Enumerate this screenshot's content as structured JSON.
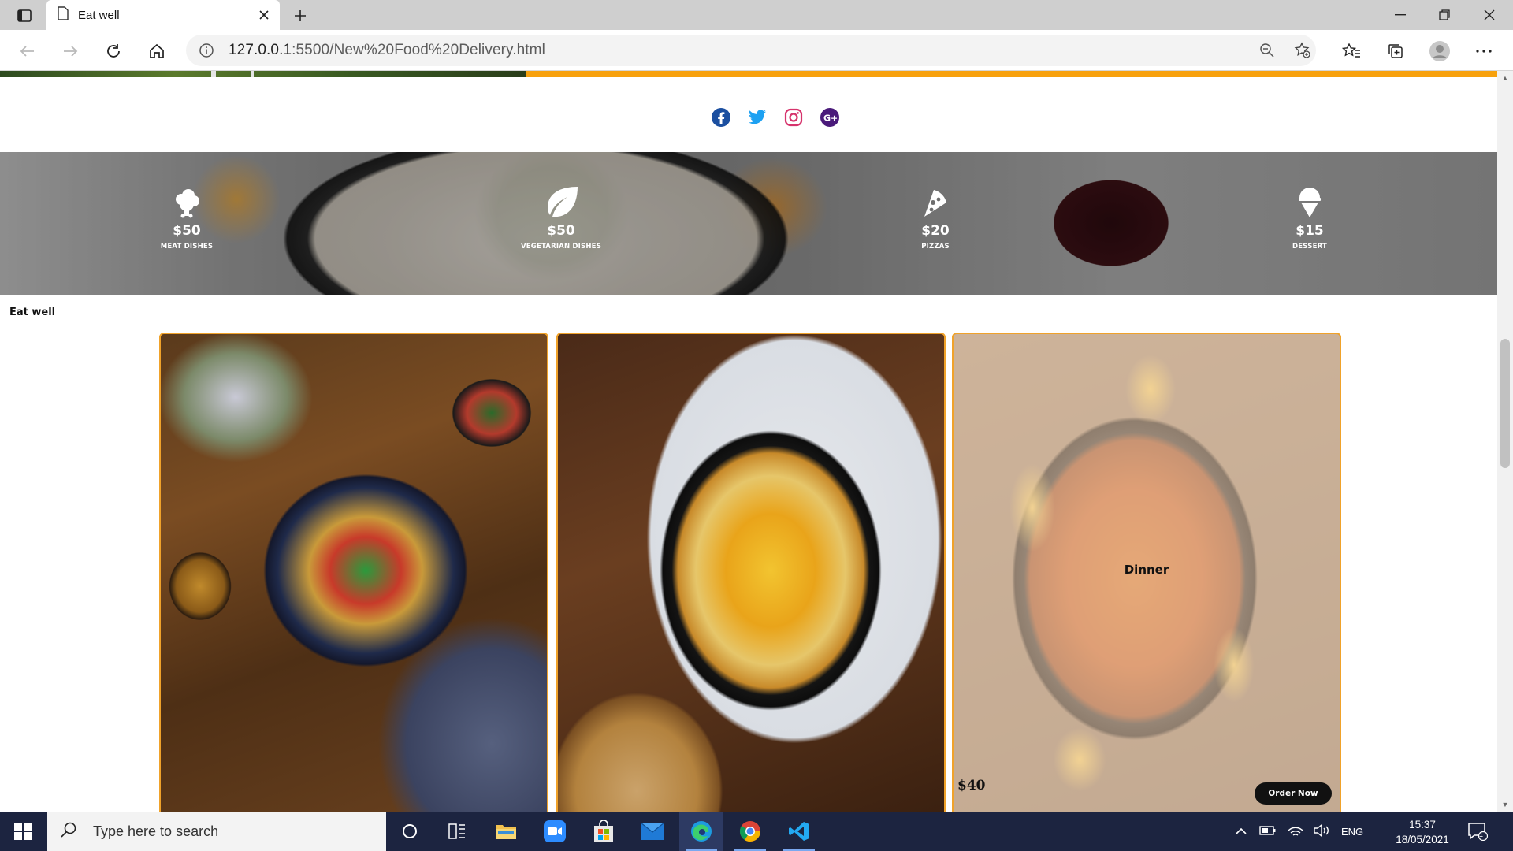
{
  "browser": {
    "tab_title": "Eat well",
    "url_host": "127.0.0.1",
    "url_path": ":5500/New%20Food%20Delivery.html"
  },
  "social": [
    "facebook-icon",
    "twitter-icon",
    "instagram-icon",
    "google-plus-icon"
  ],
  "prices": [
    {
      "amount": "$50",
      "label": "MEAT DISHES",
      "icon": "meat-icon"
    },
    {
      "amount": "$50",
      "label": "VEGETARIAN DISHES",
      "icon": "leaf-icon"
    },
    {
      "amount": "$20",
      "label": "PIZZAS",
      "icon": "pizza-icon"
    },
    {
      "amount": "$15",
      "label": "DESSERT",
      "icon": "ice-cream-icon"
    }
  ],
  "section": {
    "title": "Eat well"
  },
  "cards": [
    {
      "name": "",
      "price": ""
    },
    {
      "name": "",
      "price": ""
    },
    {
      "name": "Dinner",
      "price": "$40",
      "cta": "Order Now"
    }
  ],
  "taskbar": {
    "search_placeholder": "Type here to search",
    "language": "ENG",
    "time": "15:37",
    "date": "18/05/2021",
    "notifications": "1"
  },
  "colors": {
    "accent": "#f7a10d",
    "card_border": "#f0a22a",
    "taskbar": "#1c2440"
  }
}
